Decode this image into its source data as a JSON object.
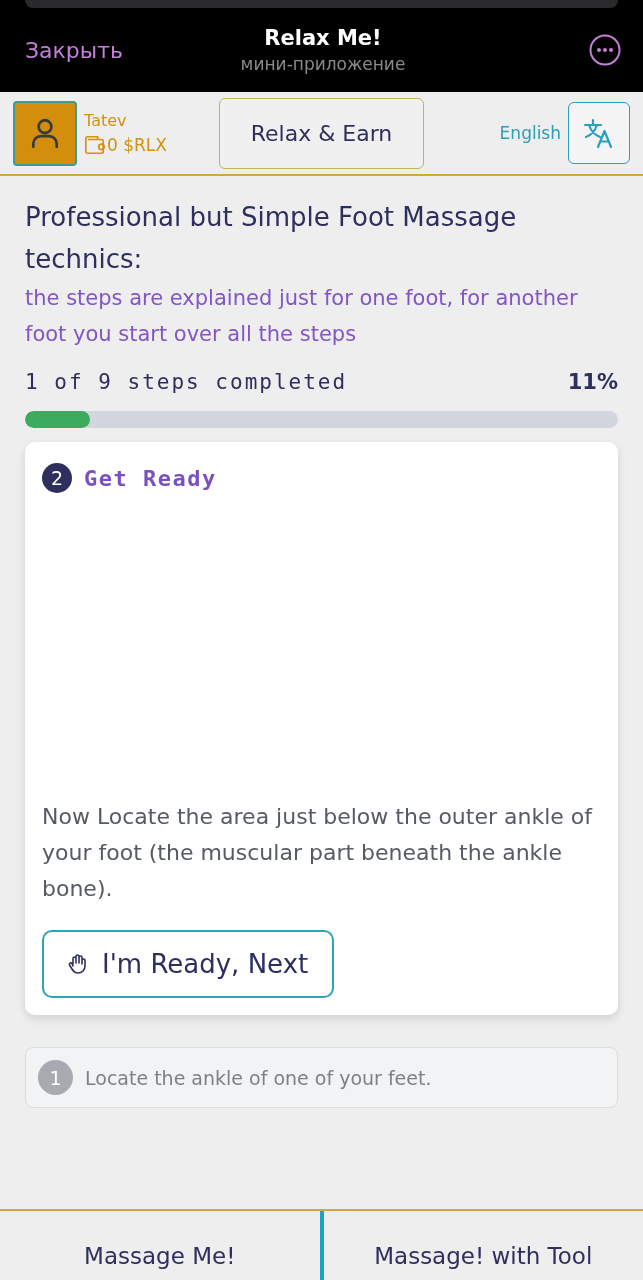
{
  "window": {
    "close": "Закрыть",
    "title": "Relax Me!",
    "subtitle": "мини-приложение"
  },
  "header": {
    "user": {
      "name": "Tatev",
      "balance": "0 $RLX"
    },
    "earn_button": "Relax & Earn",
    "language": "English"
  },
  "intro": {
    "title": "Professional but Simple Foot Massage technics:",
    "note": "the steps are explained just for one foot, for another foot you start over all the steps"
  },
  "progress": {
    "label": "1 of 9 steps completed",
    "percent": "11%",
    "level": 0.11
  },
  "steps": [
    {
      "kind": "current",
      "number": "2",
      "title": "Get Ready",
      "description": "Now Locate the area just below the outer ankle of your foot (the muscular part beneath the ankle bone).",
      "button": "I'm Ready, Next"
    },
    {
      "kind": "done",
      "number": "1",
      "text": "Locate the ankle of one of your feet."
    }
  ],
  "bottom_nav": [
    "Massage Me!",
    "Massage! with Tool"
  ]
}
